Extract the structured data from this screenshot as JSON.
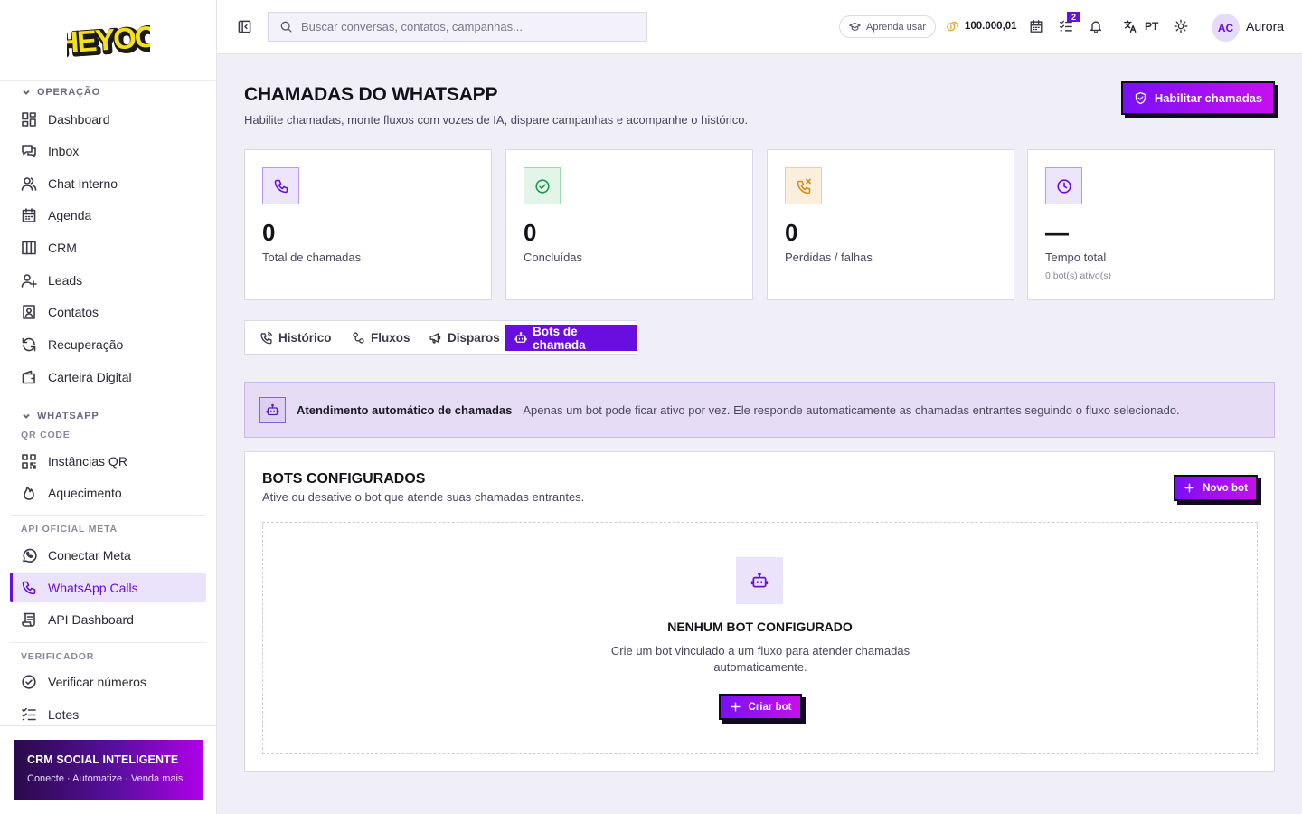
{
  "brand": {
    "logo_text": "HEYOO",
    "accent": "#6a0ee0",
    "gradient_start": "#7a10f5",
    "gradient_end": "#c80ff0"
  },
  "sidebar": {
    "sections": [
      {
        "title": "OPERAÇÃO"
      },
      {
        "title": "WHATSAPP",
        "sub": "QR CODE"
      },
      {
        "sub": "API OFICIAL META"
      },
      {
        "sub": "VERIFICADOR"
      }
    ],
    "items": [
      {
        "label": "Dashboard",
        "icon": "dashboard-icon"
      },
      {
        "label": "Inbox",
        "icon": "inbox-icon"
      },
      {
        "label": "Chat Interno",
        "icon": "users-icon"
      },
      {
        "label": "Agenda",
        "icon": "calendar-icon"
      },
      {
        "label": "CRM",
        "icon": "columns-icon"
      },
      {
        "label": "Leads",
        "icon": "user-plus-icon"
      },
      {
        "label": "Contatos",
        "icon": "contacts-icon"
      },
      {
        "label": "Recuperação",
        "icon": "refresh-icon"
      },
      {
        "label": "Carteira Digital",
        "icon": "wallet-icon"
      },
      {
        "label": "Instâncias QR",
        "icon": "qr-icon"
      },
      {
        "label": "Aquecimento",
        "icon": "flame-icon"
      },
      {
        "label": "Conectar Meta",
        "icon": "whatsapp-icon"
      },
      {
        "label": "WhatsApp Calls",
        "icon": "phone-icon",
        "active": true
      },
      {
        "label": "API Dashboard",
        "icon": "scroll-icon"
      },
      {
        "label": "Verificar números",
        "icon": "check-circle-icon"
      },
      {
        "label": "Lotes",
        "icon": "list-check-icon"
      }
    ],
    "promo": {
      "title": "CRM SOCIAL INTELIGENTE",
      "subtitle": "Conecte · Automatize · Venda mais"
    }
  },
  "topbar": {
    "search_placeholder": "Buscar conversas, contatos, campanhas...",
    "learn_label": "Aprenda usar",
    "credits": "100.000,01",
    "tasks_badge": "2",
    "language": "PT",
    "avatar_initials": "AC",
    "username": "Aurora"
  },
  "page": {
    "title": "CHAMADAS DO WHATSAPP",
    "subtitle": "Habilite chamadas, monte fluxos com vozes de IA, dispare campanhas e acompanhe o histórico.",
    "enable_button": "Habilitar chamadas"
  },
  "stats": [
    {
      "value": "0",
      "label": "Total de chamadas",
      "icon": "phone-icon",
      "color": "#6a0ee0"
    },
    {
      "value": "0",
      "label": "Concluídas",
      "icon": "check-circle-icon",
      "color": "#1a9a4a"
    },
    {
      "value": "0",
      "label": "Perdidas / falhas",
      "icon": "phone-missed-icon",
      "color": "#d48a1a"
    },
    {
      "value": "—",
      "label": "Tempo total",
      "small": "0 bot(s) ativo(s)",
      "icon": "clock-icon",
      "color": "#6a0ee0"
    }
  ],
  "tabs": [
    {
      "label": "Histórico",
      "icon": "phone-history-icon"
    },
    {
      "label": "Fluxos",
      "icon": "flow-icon"
    },
    {
      "label": "Disparos",
      "icon": "megaphone-icon"
    },
    {
      "label": "Bots de chamada",
      "icon": "bot-icon",
      "active": true
    }
  ],
  "info": {
    "title": "Atendimento automático de chamadas",
    "text": "Apenas um bot pode ficar ativo por vez. Ele responde automaticamente as chamadas entrantes seguindo o fluxo selecionado."
  },
  "bots": {
    "title": "BOTS CONFIGURADOS",
    "subtitle": "Ative ou desative o bot que atende suas chamadas entrantes.",
    "new_button": "Novo bot",
    "empty_title": "NENHUM BOT CONFIGURADO",
    "empty_text": "Crie um bot vinculado a um fluxo para atender chamadas automaticamente.",
    "create_button": "Criar bot"
  }
}
